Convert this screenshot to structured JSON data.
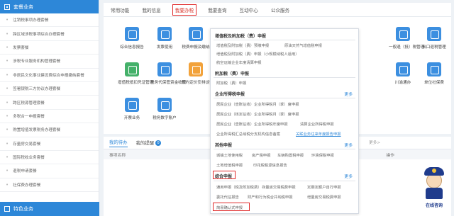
{
  "sidebar": {
    "header": "套餐业务",
    "items": [
      "注销税事项办理套餐",
      "跨区域涉税事项综合办理套餐",
      "发票套餐",
      "涉税专业服务机构管理套餐",
      "非居民文化事业建设费综合申报缴纳套餐",
      "签署银税三方协议办理套餐",
      "跨区税源管理套餐",
      "多税合一申报套餐",
      "购置增值发票税务办理套餐",
      "存量房交易套餐",
      "国际税收业务套餐",
      "退税申请套餐",
      "社保费办理套餐"
    ],
    "footer": "特色业务"
  },
  "main": {
    "tabs": [
      "常用功能",
      "我的信息",
      "我要办税",
      "我要查询",
      "互动中心",
      "公众服务"
    ],
    "active_tab": "我要办税",
    "icons_left": [
      {
        "label": "综合信息报告",
        "icon": "report-icon"
      },
      {
        "label": "发票使用",
        "icon": "invoice-icon"
      },
      {
        "label": "税费申报及缴纳",
        "icon": "tax-icon"
      },
      {
        "label": "增值税抵扣凭证管理",
        "icon": "voucher-icon"
      },
      {
        "label": "税务代保管资金收取",
        "icon": "fund-icon"
      },
      {
        "label": "预约定价安排谈签",
        "icon": "price-icon"
      },
      {
        "label": "开票业务",
        "icon": "ticket-icon"
      },
      {
        "label": "税务数字账户",
        "icon": "account-icon"
      }
    ],
    "icons_right": [
      {
        "label": "一般退（抵）税管理",
        "icon": "refund-icon"
      },
      {
        "label": "出口退税管理",
        "icon": "export-icon"
      },
      {
        "label": "川渝通办",
        "icon": "region-icon"
      },
      {
        "label": "单位社保费",
        "icon": "social-icon"
      }
    ]
  },
  "bottom": {
    "tabs": [
      "我的待办",
      "我的提醒"
    ],
    "badge": "0",
    "hint": "更多>",
    "column_name": "事项名称",
    "column_action": "操作"
  },
  "dropdown": {
    "sections": [
      {
        "title": "增值税及附加税（费）申报",
        "more": "",
        "links": [
          "增值税及附加税（费）预缴申报",
          "增值税及附加税（费）申报（小规模纳税人适用）",
          "原油天然气增值税申报",
          "航空运输企业年度清算申报"
        ]
      },
      {
        "title": "附加税（费）申报",
        "more": "",
        "links": [
          "附加税（费）申报"
        ]
      },
      {
        "title": "企业所得税申报",
        "more": "更多",
        "links": [
          "居民企业（查账征收）企业所得税月（季）度申报",
          "居民企业（核定征收）企业所得税月（季）度申报",
          "居民企业（查账征收）企业所得税年度申报",
          "清算企业所得税申报",
          "企业所得税汇总纳税分支机构信息备案",
          "关联业务往来年度报告申报"
        ]
      },
      {
        "title": "其他申报",
        "more": "更多",
        "links": [
          "城镇土地使用税",
          "房产税申报",
          "车辆购置税申报",
          "环境保税申报",
          "土地增值税申报",
          "印花税税源信息报告"
        ]
      },
      {
        "title": "综合申报",
        "more": "更多",
        "links": [
          "通用申报（税及附加税费）",
          "存量房交易税费申报",
          "定期定额户自行申报",
          "委托代征报告",
          "财产和行为税合并纳税申报",
          "增量房交易税费申报",
          "简易确认式申报"
        ]
      }
    ]
  },
  "mascot": {
    "text": "在线咨询"
  },
  "colors": {
    "primary": "#2d87d8",
    "highlight": "#e02a2a",
    "link_hover": "#2d87d8"
  }
}
